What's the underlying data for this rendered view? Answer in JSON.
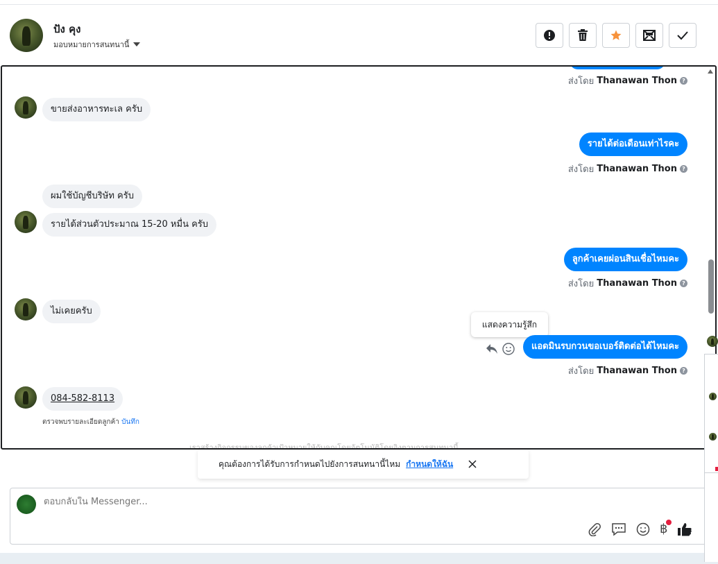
{
  "header": {
    "name": "ปัง คุง",
    "assign_label": "มอบหมายการสนทนานี้"
  },
  "messages": {
    "sent_by_prefix": "ส่งโดย",
    "agent_name": "Thanawan Thon",
    "in1": "ขายส่งอาหารทะเล ครับ",
    "out1": "รายได้ต่อเดือนเท่าไรคะ",
    "in2a": "ผมใช้บัญชีบริษัท ครับ",
    "in2b": "รายได้ส่วนตัวประมาณ 15-20 หมื่น ครับ",
    "out2": "ลูกค้าเคยผ่อนสินเชื่อไหมคะ",
    "in3": "ไม่เคยครับ",
    "out3": "แอดมินรบกวนขอเบอร์ติดต่อได้ไหมคะ",
    "in4": "084-582-8113",
    "tooltip": "แสดงความรู้สึก",
    "customer_note": "ตรวจพบรายละเอียดลูกค้า",
    "customer_note_link": "บันทึก",
    "faded_text": "เราสร้างกิจกรรมของลูกค้าเป้าหมายให้กับคุณโดยอัตโนมัติโดยอิงตามการสนทนานี้"
  },
  "prompt": {
    "text": "คุณต้องการได้รับการกำหนดไปยังการสนทนานี้ไหม",
    "link": "กำหนดให้ฉัน"
  },
  "composer": {
    "placeholder": "ตอบกลับใน Messenger...",
    "currency_symbol": "฿"
  },
  "colors": {
    "outgoing": "#0084ff",
    "incoming": "#f0f2f5",
    "star": "#f7923b",
    "link": "#1876f2"
  }
}
